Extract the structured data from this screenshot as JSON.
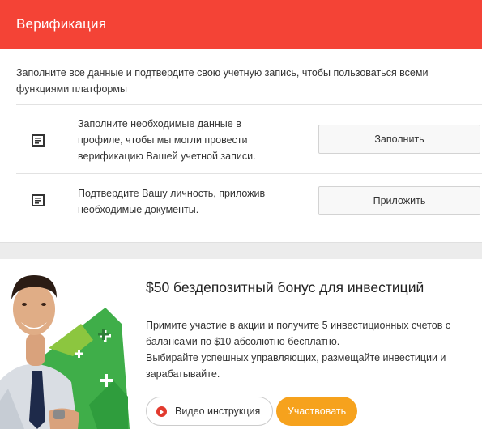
{
  "verification": {
    "title": "Верификация",
    "intro": "Заполните все данные и подтвердите свою учетную запись, чтобы пользоваться всеми функциями платформы",
    "rows": [
      {
        "icon": "form-icon",
        "text": "Заполните необходимые данные в профиле, чтобы мы могли провести верификацию Вашей учетной записи.",
        "button": "Заполнить"
      },
      {
        "icon": "document-icon",
        "text": "Подтвердите Вашу личность, приложив необходимые документы.",
        "button": "Приложить"
      }
    ]
  },
  "promo": {
    "title": "$50 бездепозитный бонус для инвестиций",
    "description": "Примите участие в акции и получите 5 инвестиционных счетов с балансами по $10 абсолютно бесплатно.\nВыбирайте успешных управляющих, размещайте инвестиции и зарабатывайте.",
    "video_button": "Видео инструкция",
    "join_button": "Участвовать"
  },
  "colors": {
    "header": "#f44336",
    "join": "#f6a21d",
    "play": "#e23a2e",
    "promo_green": "#3fae49"
  }
}
